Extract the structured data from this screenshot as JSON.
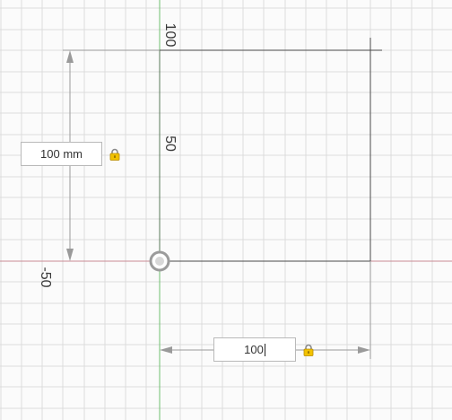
{
  "canvas": {
    "background": "#fbfbfb",
    "grid_color": "#dcdcdc",
    "x_axis_color": "#c98b94",
    "y_axis_color": "#6fbf6f",
    "sketch_line_color": "#4a4a4a",
    "dimension_color": "#9a9a9a"
  },
  "axis_labels": {
    "top": "100",
    "middle": "50",
    "left": "-50"
  },
  "dimensions": {
    "vertical": {
      "value": "100 mm"
    },
    "horizontal": {
      "value": "100"
    }
  },
  "icons": {
    "lock": "lock-icon",
    "origin": "origin-point-icon"
  }
}
